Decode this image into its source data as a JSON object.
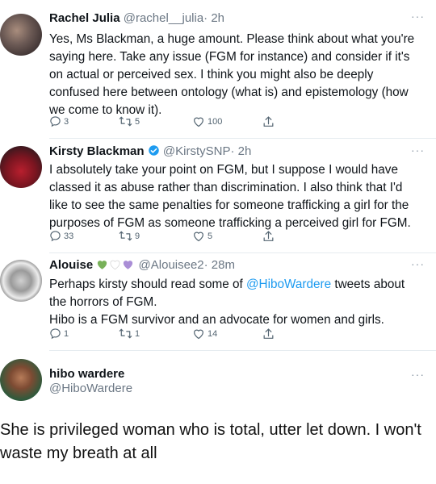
{
  "tweets": [
    {
      "name": "Rachel Julia",
      "handle": "@rachel__julia",
      "time": "· 2h",
      "body": "Yes, Ms Blackman, a huge amount. Please think about what you're saying here. Take any issue (FGM for instance) and consider if it's on actual or perceived sex. I think you might also be deeply confused here between ontology (what is) and epistemology (how we come to know it).",
      "replies": "3",
      "retweets": "5",
      "likes": "100"
    },
    {
      "name": "Kirsty Blackman",
      "handle": "@KirstySNP",
      "time": "· 2h",
      "body": "I absolutely take your point on FGM, but I suppose I would have classed it as abuse rather than discrimination. I also think that I'd like to see the same penalties for someone trafficking a girl for the purposes of FGM as someone trafficking a perceived girl for FGM.",
      "replies": "33",
      "retweets": "9",
      "likes": "5"
    },
    {
      "name": "Alouise",
      "handle": "@Alouisee2",
      "time": "· 28m",
      "body_before": "Perhaps kirsty should read some of ",
      "body_link": "@HiboWardere",
      "body_after": "  tweets about the horrors of FGM.",
      "body_line2": "Hibo is a FGM survivor and an advocate for women and girls.",
      "replies": "1",
      "retweets": "1",
      "likes": "14"
    }
  ],
  "profile": {
    "name": "hibo wardere",
    "handle": "@HiboWardere"
  },
  "caption": "She is privileged woman who is total, utter let down.  I won't waste my breath at all",
  "more_glyph": "···",
  "colors": {
    "link": "#1d9bf0",
    "verified": "#1d9bf0",
    "heart_green": "#78b159",
    "heart_white": "#ffffff",
    "heart_purple": "#aa8ed6"
  }
}
